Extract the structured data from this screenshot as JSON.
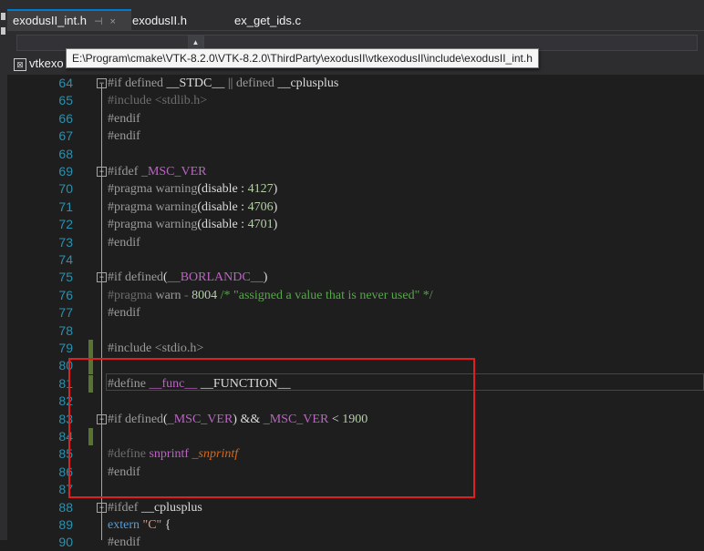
{
  "tabs": [
    {
      "label": "exodusII_int.h",
      "pin": "⊣",
      "close": "×",
      "active": true
    },
    {
      "label": "exodusII.h",
      "active": false
    },
    {
      "label": "ex_get_ids.c",
      "active": false
    }
  ],
  "tooltip": "E:\\Program\\cmake\\VTK-8.2.0\\VTK-8.2.0\\ThirdParty\\exodusII\\vtkexodusII\\include\\exodusII_int.h",
  "project_label": "vtkexo",
  "combo_arrow": "▲",
  "lines": [
    {
      "n": "64",
      "fold": true,
      "bar": false,
      "segs": [
        [
          "pp",
          "#if "
        ],
        [
          "pp",
          "defined "
        ],
        [
          "plain",
          "__STDC__ "
        ],
        [
          "pp",
          "|| "
        ],
        [
          "pp",
          "defined "
        ],
        [
          "plain",
          "__cplusplus"
        ]
      ]
    },
    {
      "n": "65",
      "fold": false,
      "bar": false,
      "segs": [
        [
          "ppd",
          "#include "
        ],
        [
          "ppd",
          "<stdlib.h>"
        ]
      ]
    },
    {
      "n": "66",
      "fold": false,
      "bar": false,
      "segs": [
        [
          "pp",
          "#endif"
        ]
      ]
    },
    {
      "n": "67",
      "fold": false,
      "bar": false,
      "segs": [
        [
          "pp",
          "#endif"
        ]
      ]
    },
    {
      "n": "68",
      "fold": false,
      "bar": false,
      "segs": []
    },
    {
      "n": "69",
      "fold": true,
      "bar": false,
      "segs": [
        [
          "pp",
          "#ifdef "
        ],
        [
          "macro",
          "_MSC_VER"
        ]
      ]
    },
    {
      "n": "70",
      "fold": false,
      "bar": false,
      "segs": [
        [
          "pp",
          "#pragma warning"
        ],
        [
          "plain",
          "(disable : "
        ],
        [
          "num",
          "4127"
        ],
        [
          "plain",
          ")"
        ]
      ]
    },
    {
      "n": "71",
      "fold": false,
      "bar": false,
      "segs": [
        [
          "pp",
          "#pragma warning"
        ],
        [
          "plain",
          "(disable : "
        ],
        [
          "num",
          "4706"
        ],
        [
          "plain",
          ")"
        ]
      ]
    },
    {
      "n": "72",
      "fold": false,
      "bar": false,
      "segs": [
        [
          "pp",
          "#pragma warning"
        ],
        [
          "plain",
          "(disable : "
        ],
        [
          "num",
          "4701"
        ],
        [
          "plain",
          ")"
        ]
      ]
    },
    {
      "n": "73",
      "fold": false,
      "bar": false,
      "segs": [
        [
          "pp",
          "#endif"
        ]
      ]
    },
    {
      "n": "74",
      "fold": false,
      "bar": false,
      "segs": []
    },
    {
      "n": "75",
      "fold": true,
      "bar": false,
      "segs": [
        [
          "pp",
          "#if defined"
        ],
        [
          "plain",
          "("
        ],
        [
          "macro",
          "__BORLANDC__"
        ],
        [
          "plain",
          ")"
        ]
      ]
    },
    {
      "n": "76",
      "fold": false,
      "bar": false,
      "segs": [
        [
          "ppd",
          "#pragma "
        ],
        [
          "pp",
          "warn "
        ],
        [
          "ppd",
          "- "
        ],
        [
          "num",
          "8004 "
        ],
        [
          "com",
          "/* \"assigned a value that is never used\" */"
        ]
      ]
    },
    {
      "n": "77",
      "fold": false,
      "bar": false,
      "segs": [
        [
          "pp",
          "#endif"
        ]
      ]
    },
    {
      "n": "78",
      "fold": false,
      "bar": false,
      "segs": []
    },
    {
      "n": "79",
      "fold": false,
      "bar": true,
      "segs": [
        [
          "pp",
          "#include "
        ],
        [
          "pp",
          "<stdio.h>"
        ]
      ]
    },
    {
      "n": "80",
      "fold": false,
      "bar": true,
      "segs": []
    },
    {
      "n": "81",
      "fold": false,
      "bar": true,
      "segs": [
        [
          "pp",
          "#define "
        ],
        [
          "macro",
          "__func__ "
        ],
        [
          "plain",
          "__FUNCTION__"
        ]
      ]
    },
    {
      "n": "82",
      "fold": false,
      "bar": false,
      "segs": []
    },
    {
      "n": "83",
      "fold": true,
      "bar": false,
      "segs": [
        [
          "pp",
          "#if defined"
        ],
        [
          "plain",
          "("
        ],
        [
          "macro",
          "_MSC_VER"
        ],
        [
          "plain",
          ") && "
        ],
        [
          "macro",
          "_MSC_VER "
        ],
        [
          "plain",
          "< "
        ],
        [
          "num",
          "1900"
        ]
      ]
    },
    {
      "n": "84",
      "fold": false,
      "bar": true,
      "segs": []
    },
    {
      "n": "85",
      "fold": false,
      "bar": false,
      "segs": [
        [
          "ppd",
          "#define "
        ],
        [
          "macro",
          "snprintf "
        ],
        [
          "ital",
          "_snprintf"
        ]
      ]
    },
    {
      "n": "86",
      "fold": false,
      "bar": false,
      "segs": [
        [
          "pp",
          "#endif"
        ]
      ]
    },
    {
      "n": "87",
      "fold": false,
      "bar": false,
      "segs": []
    },
    {
      "n": "88",
      "fold": true,
      "bar": false,
      "segs": [
        [
          "pp",
          "#ifdef "
        ],
        [
          "plain",
          "__cplusplus"
        ]
      ]
    },
    {
      "n": "89",
      "fold": false,
      "bar": false,
      "segs": [
        [
          "kw",
          "extern "
        ],
        [
          "str",
          "\"C\" "
        ],
        [
          "plain",
          "{"
        ]
      ]
    },
    {
      "n": "90",
      "fold": false,
      "bar": false,
      "segs": [
        [
          "pp",
          "#endif"
        ]
      ]
    }
  ],
  "highlight": {
    "color": "#e02020"
  }
}
